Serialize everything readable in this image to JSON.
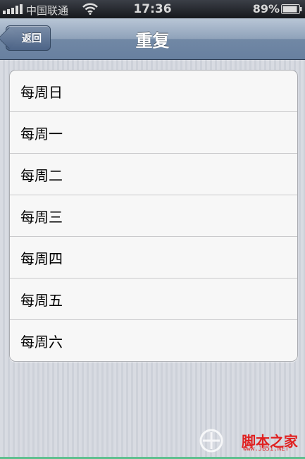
{
  "status_bar": {
    "carrier": "中国联通",
    "time": "17:36",
    "battery": "89%",
    "icons": [
      "signal-icon",
      "wifi-icon",
      "battery-icon"
    ]
  },
  "nav": {
    "back_label": "返回",
    "title": "重复"
  },
  "days": [
    {
      "label": "每周日"
    },
    {
      "label": "每周一"
    },
    {
      "label": "每周二"
    },
    {
      "label": "每周三"
    },
    {
      "label": "每周四"
    },
    {
      "label": "每周五"
    },
    {
      "label": "每周六"
    }
  ],
  "watermark": {
    "text": "脚本之家",
    "url": "www.JB51.NET"
  },
  "colors": {
    "nav_bar": "#6880a0",
    "status_bar": "#16181c",
    "watermark": "#e02020"
  }
}
